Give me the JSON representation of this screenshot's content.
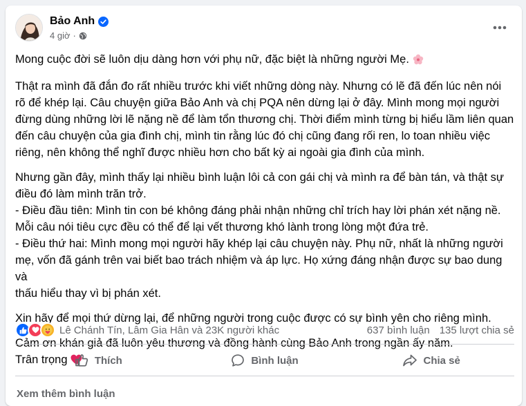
{
  "post": {
    "author": "Bảo Anh",
    "time": "4 giờ",
    "paragraphs": [
      "Mong cuộc đời sẽ luôn dịu dàng hơn với phụ nữ, đặc biệt là những người Mẹ.",
      "Thật ra mình đã đắn đo rất nhiều trước khi viết những dòng này. Nhưng có lẽ đã đến lúc nên nói\nrõ để khép lại. Câu chuyện giữa Bảo Anh và chị PQA nên dừng lại ở đây. Mình mong mọi người\nđừng dùng những lời lẽ nặng nề để làm tổn thương chị. Thời điểm mình từng bị hiểu lầm liên quan\nđến câu chuyện của gia đình chị, mình tin rằng lúc đó chị cũng đang rối ren, lo toan nhiều việc\nriêng, nên không thể nghĩ được nhiều hơn cho bất kỳ ai ngoài gia đình của mình.",
      "Nhưng gần đây, mình thấy lại nhiều bình luận lôi cả con gái chị và mình ra để bàn tán, và thật sự\nđiều đó làm mình trăn trở.\n- Điều đầu tiên: Mình tin con bé không đáng phải nhận những chỉ trích hay lời phán xét nặng nề.\nMỗi câu nói tiêu cực đều có thể để lại vết thương khó lành trong lòng một đứa trẻ.\n- Điều thứ hai: Mình mong mọi người hãy khép lại câu chuyện này. Phụ nữ, nhất là những người\nmẹ, vốn đã gánh trên vai biết bao trách nhiệm và áp lực. Họ xứng đáng nhận được sự bao dung và\nthấu hiểu thay vì bị phán xét.",
      "Xin hãy để mọi thứ dừng lại, để những người trong cuộc được có sự bình yên cho riêng mình.",
      "Cảm ơn khán giả đã luôn yêu thương và đồng hành cùng Bảo Anh trong ngần ấy năm.",
      "Trân trọng"
    ],
    "icons": {
      "verified": "verified-badge-icon",
      "privacy": "globe-icon",
      "flower_emoji": "🌸",
      "heart_emoji": "❤"
    }
  },
  "stats": {
    "reactors": "Lê Chánh Tín, Lâm Gia Hân và 23K người khác",
    "comments": "637 bình luận",
    "shares": "135 lượt chia sẻ"
  },
  "actions": {
    "like": "Thích",
    "comment": "Bình luận",
    "share": "Chia sẻ"
  },
  "footer": {
    "more_comments": "Xem thêm bình luận"
  },
  "colors": {
    "facebook_blue": "#0866ff",
    "love_red": "#f33e58",
    "secondary_text": "#65676b"
  }
}
